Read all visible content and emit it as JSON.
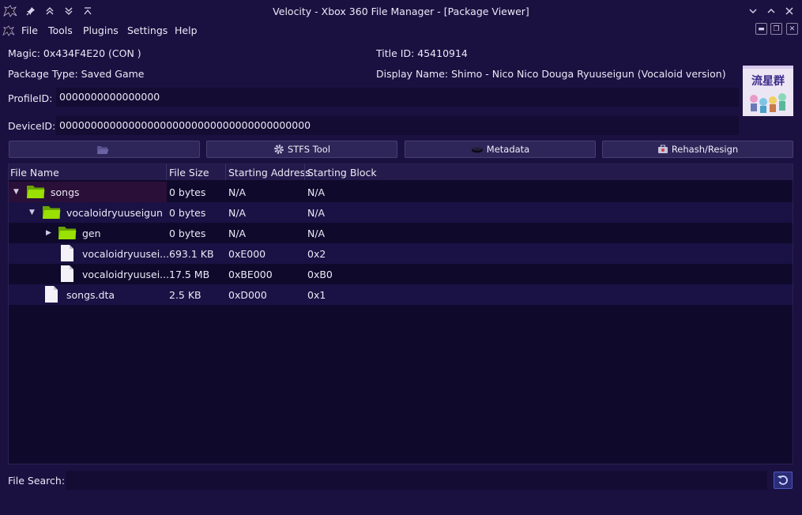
{
  "window": {
    "title": "Velocity - Xbox 360 File Manager - [Package Viewer]"
  },
  "menu": {
    "items": [
      "File",
      "Tools",
      "Plugins",
      "Settings",
      "Help"
    ]
  },
  "info": {
    "magic": "Magic: 0x434F4E20 (CON )",
    "title_id": "Title ID: 45410914",
    "package_type": "Package Type: Saved Game",
    "display_name": "Display Name: Shimo - Nico Nico Douga Ryuuseigun (Vocaloid version)"
  },
  "fields": {
    "profile_label": "ProfileID:",
    "profile_value": "0000000000000000",
    "device_label": "DeviceID:",
    "device_value": "0000000000000000000000000000000000000000"
  },
  "thumbnail": {
    "text": "流星群"
  },
  "toolbar": {
    "buttons": [
      {
        "label": "",
        "icon": "folder-open-icon",
        "enabled": false
      },
      {
        "label": "STFS Tool",
        "icon": "gear-icon",
        "enabled": true
      },
      {
        "label": "Metadata",
        "icon": "metadata-icon",
        "enabled": true
      },
      {
        "label": "Rehash/Resign",
        "icon": "toolbox-icon",
        "enabled": true
      }
    ]
  },
  "table": {
    "columns": [
      "File Name",
      "File Size",
      "Starting Address",
      "Starting Block"
    ],
    "rows": [
      {
        "name": "songs",
        "size": "0 bytes",
        "address": "N/A",
        "block": "N/A",
        "type": "folder",
        "depth": 0,
        "expander": "expanded",
        "selected": true
      },
      {
        "name": "vocaloidryuuseigun",
        "size": "0 bytes",
        "address": "N/A",
        "block": "N/A",
        "type": "folder",
        "depth": 1,
        "expander": "expanded",
        "selected": false
      },
      {
        "name": "gen",
        "size": "0 bytes",
        "address": "N/A",
        "block": "N/A",
        "type": "folder",
        "depth": 2,
        "expander": "collapsed",
        "selected": false
      },
      {
        "name": "vocaloidryuusei...",
        "size": "693.1 KB",
        "address": "0xE000",
        "block": "0x2",
        "type": "file",
        "depth": 2,
        "expander": "none",
        "selected": false
      },
      {
        "name": "vocaloidryuusei...",
        "size": "17.5 MB",
        "address": "0xBE000",
        "block": "0xB0",
        "type": "file",
        "depth": 2,
        "expander": "none",
        "selected": false
      },
      {
        "name": "songs.dta",
        "size": "2.5 KB",
        "address": "0xD000",
        "block": "0x1",
        "type": "file",
        "depth": 1,
        "expander": "none",
        "selected": false
      }
    ]
  },
  "search": {
    "label": "File Search:",
    "value": ""
  },
  "colors": {
    "background": "#1b1141",
    "folder_green": "#8cd600",
    "selection": "#2a0f38",
    "accent_blue": "#4b58b8"
  }
}
